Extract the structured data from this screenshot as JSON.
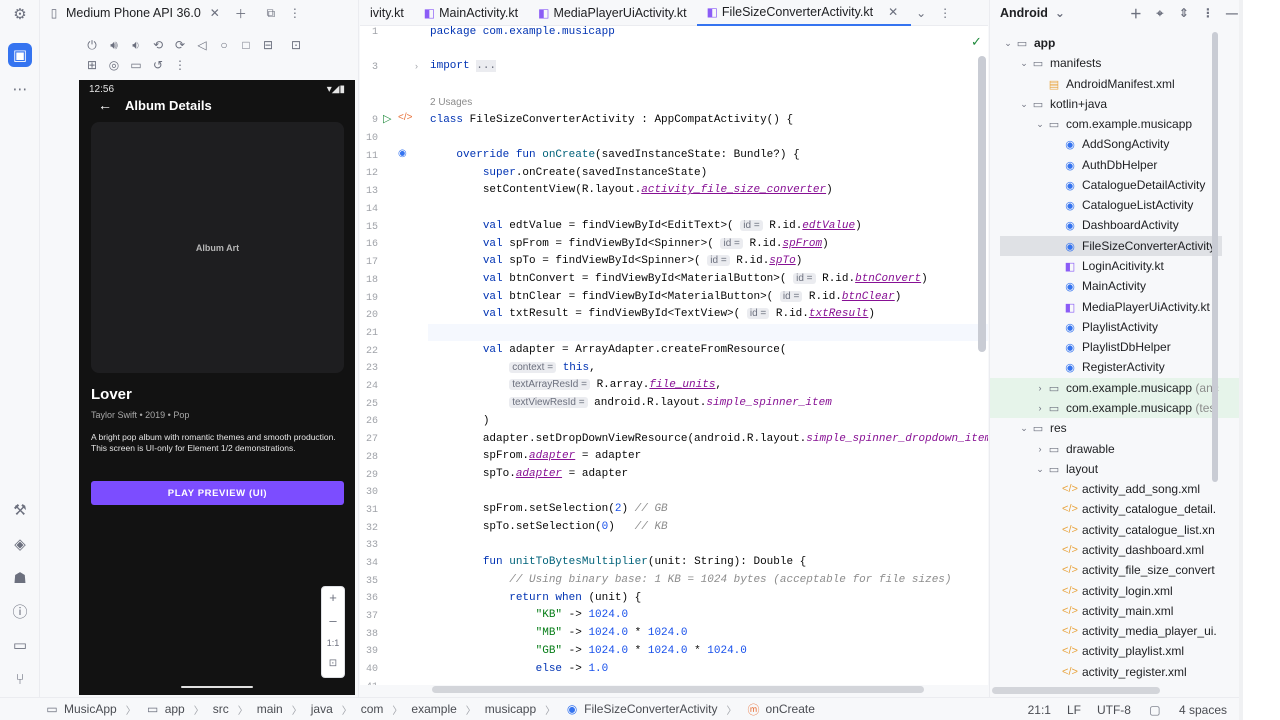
{
  "device_tab": {
    "label": "Medium Phone API 36.0"
  },
  "editor_tabs": [
    {
      "label": "ivity.kt",
      "active": false
    },
    {
      "label": "MainActivity.kt",
      "active": false
    },
    {
      "label": "MediaPlayerUiActivity.kt",
      "active": false
    },
    {
      "label": "FileSizeConverterActivity.kt",
      "active": true
    }
  ],
  "phone": {
    "time": "12:56",
    "title": "Album Details",
    "album_art": "Album Art",
    "song_title": "Lover",
    "meta": "Taylor Swift • 2019 • Pop",
    "description": "A bright pop album with romantic themes and smooth production. This screen is UI-only for Element 1/2 demonstrations.",
    "play_button": "PLAY PREVIEW (UI)"
  },
  "zoom": {
    "plus": "+",
    "minus": "–",
    "one_to_one": "1:1"
  },
  "editor": {
    "usages": "2 Usages",
    "line_numbers": [
      "1",
      "3",
      "9",
      "10",
      "11",
      "12",
      "13",
      "14",
      "15",
      "16",
      "17",
      "18",
      "19",
      "20",
      "21",
      "22",
      "23",
      "24",
      "25",
      "26",
      "27",
      "28",
      "29",
      "30",
      "31",
      "32",
      "33",
      "34",
      "35",
      "36",
      "37",
      "38",
      "39",
      "40",
      "41"
    ]
  },
  "code": {
    "l1": "package com.example.musicapp",
    "l3a": "import",
    "l3b": "...",
    "l9a": "class",
    "l9b": "FileSizeConverterActivity",
    "l9c": " : AppCompatActivity() {",
    "l11a": "override fun",
    "l11b": "onCreate",
    "l11c": "(savedInstanceState: Bundle?) {",
    "l12a": "super",
    "l12b": ".onCreate(savedInstanceState)",
    "l13a": "setContentView(R.layout.",
    "l13b": "activity_file_size_converter",
    "l13c": ")",
    "l15a": "val",
    "l15b": " edtValue = findViewById<EditText>(",
    "l15h": "id =",
    "l15c": " R.id.",
    "l15d": "edtValue",
    "l15e": ")",
    "l16a": "val",
    "l16b": " spFrom = findViewById<Spinner>(",
    "l16h": "id =",
    "l16c": " R.id.",
    "l16d": "spFrom",
    "l16e": ")",
    "l17a": "val",
    "l17b": " spTo = findViewById<Spinner>(",
    "l17h": "id =",
    "l17c": " R.id.",
    "l17d": "spTo",
    "l17e": ")",
    "l18a": "val",
    "l18b": " btnConvert = findViewById<MaterialButton>(",
    "l18h": "id =",
    "l18c": " R.id.",
    "l18d": "btnConvert",
    "l18e": ")",
    "l19a": "val",
    "l19b": " btnClear = findViewById<MaterialButton>(",
    "l19h": "id =",
    "l19c": " R.id.",
    "l19d": "btnClear",
    "l19e": ")",
    "l20a": "val",
    "l20b": " txtResult = findViewById<TextView>(",
    "l20h": "id =",
    "l20c": " R.id.",
    "l20d": "txtResult",
    "l20e": ")",
    "l22a": "val",
    "l22b": " adapter = ArrayAdapter.createFromResource(",
    "l23h": "context =",
    "l23b": "this",
    "l23c": ",",
    "l24h": "textArrayResId =",
    "l24b": " R.array.",
    "l24c": "file_units",
    "l24d": ",",
    "l25h": "textViewResId =",
    "l25b": " android.R.layout.",
    "l25c": "simple_spinner_item",
    "l26": ")",
    "l27a": "adapter.setDropDownViewResource(android.R.layout.",
    "l27b": "simple_spinner_dropdown_item",
    "l27c": ")",
    "l28a": "spFrom.",
    "l28b": "adapter",
    "l28c": " = adapter",
    "l29a": "spTo.",
    "l29b": "adapter",
    "l29c": " = adapter",
    "l31a": "spFrom.setSelection(",
    "l31b": "2",
    "l31c": ") ",
    "l31d": "// GB",
    "l32a": "spTo.setSelection(",
    "l32b": "0",
    "l32c": ")   ",
    "l32d": "// KB",
    "l34a": "fun",
    "l34b": "unitToBytesMultiplier",
    "l34c": "(unit: String): Double {",
    "l35": "// Using binary base: 1 KB = 1024 bytes (acceptable for file sizes)",
    "l36a": "return when",
    "l36b": " (unit) {",
    "l37a": "\"KB\"",
    "l37b": " -> ",
    "l37c": "1024.0",
    "l38a": "\"MB\"",
    "l38b": " -> ",
    "l38c": "1024.0",
    "l38d": " * ",
    "l38e": "1024.0",
    "l39a": "\"GB\"",
    "l39b": " -> ",
    "l39c": "1024.0",
    "l39d": " * ",
    "l39e": "1024.0",
    "l39f": " * ",
    "l39g": "1024.0",
    "l40a": "else",
    "l40b": " -> ",
    "l40c": "1.0"
  },
  "project": {
    "view_label": "Android",
    "tree": [
      {
        "label": "app"
      },
      {
        "label": "manifests"
      },
      {
        "label": "AndroidManifest.xml"
      },
      {
        "label": "kotlin+java"
      },
      {
        "label": "com.example.musicapp"
      },
      {
        "label": "AddSongActivity"
      },
      {
        "label": "AuthDbHelper"
      },
      {
        "label": "CatalogueDetailActivity"
      },
      {
        "label": "CatalogueListActivity"
      },
      {
        "label": "DashboardActivity"
      },
      {
        "label": "FileSizeConverterActivity"
      },
      {
        "label": "LoginAcitivity.kt"
      },
      {
        "label": "MainActivity"
      },
      {
        "label": "MediaPlayerUiActivity.kt"
      },
      {
        "label": "PlaylistActivity"
      },
      {
        "label": "PlaylistDbHelper"
      },
      {
        "label": "RegisterActivity"
      },
      {
        "label": "com.example.musicapp",
        "suffix": "(anc"
      },
      {
        "label": "com.example.musicapp",
        "suffix": "(tes"
      },
      {
        "label": "res"
      },
      {
        "label": "drawable"
      },
      {
        "label": "layout"
      },
      {
        "label": "activity_add_song.xml"
      },
      {
        "label": "activity_catalogue_detail."
      },
      {
        "label": "activity_catalogue_list.xn"
      },
      {
        "label": "activity_dashboard.xml"
      },
      {
        "label": "activity_file_size_convert"
      },
      {
        "label": "activity_login.xml"
      },
      {
        "label": "activity_main.xml"
      },
      {
        "label": "activity_media_player_ui."
      },
      {
        "label": "activity_playlist.xml"
      },
      {
        "label": "activity_register.xml"
      }
    ]
  },
  "statusbar": {
    "crumbs": [
      "MusicApp",
      "app",
      "src",
      "main",
      "java",
      "com",
      "example",
      "musicapp",
      "FileSizeConverterActivity",
      "onCreate"
    ],
    "position": "21:1",
    "line_sep": "LF",
    "encoding": "UTF-8",
    "indent": "4 spaces"
  }
}
